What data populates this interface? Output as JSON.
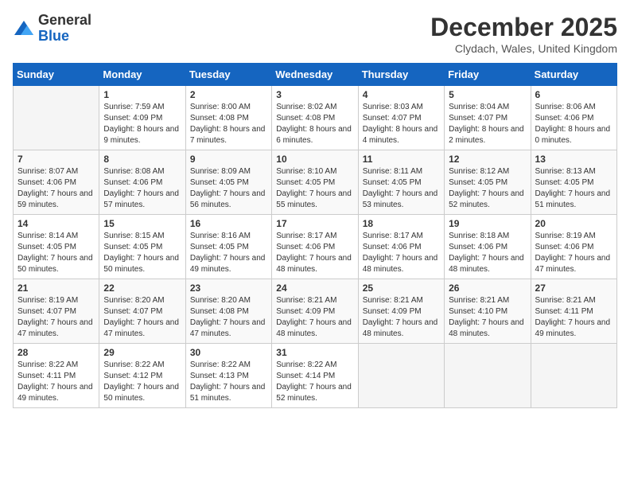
{
  "logo": {
    "general": "General",
    "blue": "Blue"
  },
  "header": {
    "month_year": "December 2025",
    "location": "Clydach, Wales, United Kingdom"
  },
  "days_of_week": [
    "Sunday",
    "Monday",
    "Tuesday",
    "Wednesday",
    "Thursday",
    "Friday",
    "Saturday"
  ],
  "weeks": [
    [
      {
        "day": "",
        "sunrise": "",
        "sunset": "",
        "daylight": ""
      },
      {
        "day": "1",
        "sunrise": "Sunrise: 7:59 AM",
        "sunset": "Sunset: 4:09 PM",
        "daylight": "Daylight: 8 hours and 9 minutes."
      },
      {
        "day": "2",
        "sunrise": "Sunrise: 8:00 AM",
        "sunset": "Sunset: 4:08 PM",
        "daylight": "Daylight: 8 hours and 7 minutes."
      },
      {
        "day": "3",
        "sunrise": "Sunrise: 8:02 AM",
        "sunset": "Sunset: 4:08 PM",
        "daylight": "Daylight: 8 hours and 6 minutes."
      },
      {
        "day": "4",
        "sunrise": "Sunrise: 8:03 AM",
        "sunset": "Sunset: 4:07 PM",
        "daylight": "Daylight: 8 hours and 4 minutes."
      },
      {
        "day": "5",
        "sunrise": "Sunrise: 8:04 AM",
        "sunset": "Sunset: 4:07 PM",
        "daylight": "Daylight: 8 hours and 2 minutes."
      },
      {
        "day": "6",
        "sunrise": "Sunrise: 8:06 AM",
        "sunset": "Sunset: 4:06 PM",
        "daylight": "Daylight: 8 hours and 0 minutes."
      }
    ],
    [
      {
        "day": "7",
        "sunrise": "Sunrise: 8:07 AM",
        "sunset": "Sunset: 4:06 PM",
        "daylight": "Daylight: 7 hours and 59 minutes."
      },
      {
        "day": "8",
        "sunrise": "Sunrise: 8:08 AM",
        "sunset": "Sunset: 4:06 PM",
        "daylight": "Daylight: 7 hours and 57 minutes."
      },
      {
        "day": "9",
        "sunrise": "Sunrise: 8:09 AM",
        "sunset": "Sunset: 4:05 PM",
        "daylight": "Daylight: 7 hours and 56 minutes."
      },
      {
        "day": "10",
        "sunrise": "Sunrise: 8:10 AM",
        "sunset": "Sunset: 4:05 PM",
        "daylight": "Daylight: 7 hours and 55 minutes."
      },
      {
        "day": "11",
        "sunrise": "Sunrise: 8:11 AM",
        "sunset": "Sunset: 4:05 PM",
        "daylight": "Daylight: 7 hours and 53 minutes."
      },
      {
        "day": "12",
        "sunrise": "Sunrise: 8:12 AM",
        "sunset": "Sunset: 4:05 PM",
        "daylight": "Daylight: 7 hours and 52 minutes."
      },
      {
        "day": "13",
        "sunrise": "Sunrise: 8:13 AM",
        "sunset": "Sunset: 4:05 PM",
        "daylight": "Daylight: 7 hours and 51 minutes."
      }
    ],
    [
      {
        "day": "14",
        "sunrise": "Sunrise: 8:14 AM",
        "sunset": "Sunset: 4:05 PM",
        "daylight": "Daylight: 7 hours and 50 minutes."
      },
      {
        "day": "15",
        "sunrise": "Sunrise: 8:15 AM",
        "sunset": "Sunset: 4:05 PM",
        "daylight": "Daylight: 7 hours and 50 minutes."
      },
      {
        "day": "16",
        "sunrise": "Sunrise: 8:16 AM",
        "sunset": "Sunset: 4:05 PM",
        "daylight": "Daylight: 7 hours and 49 minutes."
      },
      {
        "day": "17",
        "sunrise": "Sunrise: 8:17 AM",
        "sunset": "Sunset: 4:06 PM",
        "daylight": "Daylight: 7 hours and 48 minutes."
      },
      {
        "day": "18",
        "sunrise": "Sunrise: 8:17 AM",
        "sunset": "Sunset: 4:06 PM",
        "daylight": "Daylight: 7 hours and 48 minutes."
      },
      {
        "day": "19",
        "sunrise": "Sunrise: 8:18 AM",
        "sunset": "Sunset: 4:06 PM",
        "daylight": "Daylight: 7 hours and 48 minutes."
      },
      {
        "day": "20",
        "sunrise": "Sunrise: 8:19 AM",
        "sunset": "Sunset: 4:06 PM",
        "daylight": "Daylight: 7 hours and 47 minutes."
      }
    ],
    [
      {
        "day": "21",
        "sunrise": "Sunrise: 8:19 AM",
        "sunset": "Sunset: 4:07 PM",
        "daylight": "Daylight: 7 hours and 47 minutes."
      },
      {
        "day": "22",
        "sunrise": "Sunrise: 8:20 AM",
        "sunset": "Sunset: 4:07 PM",
        "daylight": "Daylight: 7 hours and 47 minutes."
      },
      {
        "day": "23",
        "sunrise": "Sunrise: 8:20 AM",
        "sunset": "Sunset: 4:08 PM",
        "daylight": "Daylight: 7 hours and 47 minutes."
      },
      {
        "day": "24",
        "sunrise": "Sunrise: 8:21 AM",
        "sunset": "Sunset: 4:09 PM",
        "daylight": "Daylight: 7 hours and 48 minutes."
      },
      {
        "day": "25",
        "sunrise": "Sunrise: 8:21 AM",
        "sunset": "Sunset: 4:09 PM",
        "daylight": "Daylight: 7 hours and 48 minutes."
      },
      {
        "day": "26",
        "sunrise": "Sunrise: 8:21 AM",
        "sunset": "Sunset: 4:10 PM",
        "daylight": "Daylight: 7 hours and 48 minutes."
      },
      {
        "day": "27",
        "sunrise": "Sunrise: 8:21 AM",
        "sunset": "Sunset: 4:11 PM",
        "daylight": "Daylight: 7 hours and 49 minutes."
      }
    ],
    [
      {
        "day": "28",
        "sunrise": "Sunrise: 8:22 AM",
        "sunset": "Sunset: 4:11 PM",
        "daylight": "Daylight: 7 hours and 49 minutes."
      },
      {
        "day": "29",
        "sunrise": "Sunrise: 8:22 AM",
        "sunset": "Sunset: 4:12 PM",
        "daylight": "Daylight: 7 hours and 50 minutes."
      },
      {
        "day": "30",
        "sunrise": "Sunrise: 8:22 AM",
        "sunset": "Sunset: 4:13 PM",
        "daylight": "Daylight: 7 hours and 51 minutes."
      },
      {
        "day": "31",
        "sunrise": "Sunrise: 8:22 AM",
        "sunset": "Sunset: 4:14 PM",
        "daylight": "Daylight: 7 hours and 52 minutes."
      },
      {
        "day": "",
        "sunrise": "",
        "sunset": "",
        "daylight": ""
      },
      {
        "day": "",
        "sunrise": "",
        "sunset": "",
        "daylight": ""
      },
      {
        "day": "",
        "sunrise": "",
        "sunset": "",
        "daylight": ""
      }
    ]
  ]
}
